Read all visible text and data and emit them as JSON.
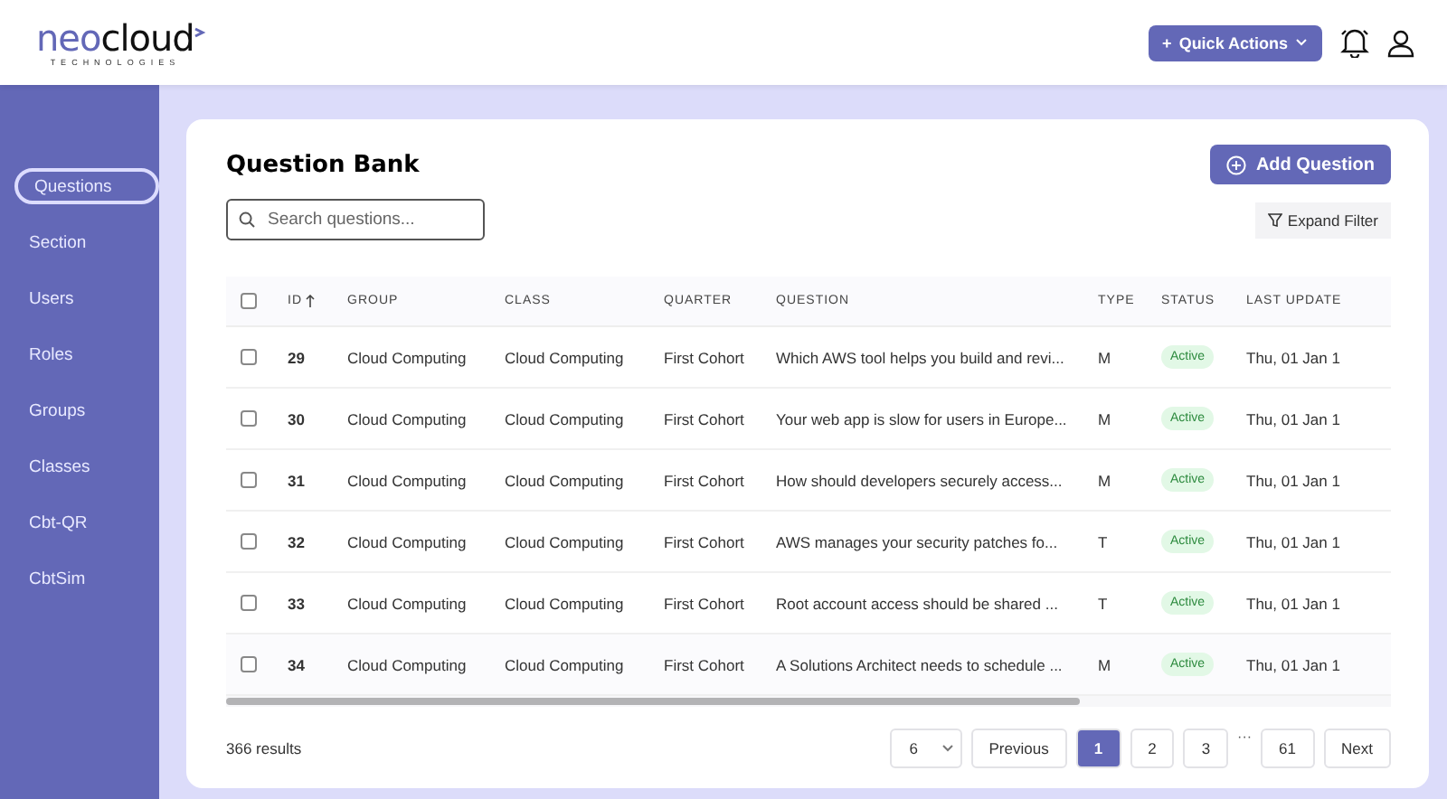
{
  "header": {
    "logo": {
      "brand_part1": "neo",
      "brand_part2": "cloud",
      "tagline": "TECHNOLOGIES"
    },
    "quick_actions": {
      "label": "Quick Actions",
      "prefix": "+"
    }
  },
  "sidebar": {
    "items": [
      {
        "label": "Questions",
        "selected": true
      },
      {
        "label": "Section",
        "selected": false
      },
      {
        "label": "Users",
        "selected": false
      },
      {
        "label": "Roles",
        "selected": false
      },
      {
        "label": "Groups",
        "selected": false
      },
      {
        "label": "Classes",
        "selected": false
      },
      {
        "label": "Cbt-QR",
        "selected": false
      },
      {
        "label": "CbtSim",
        "selected": false
      }
    ]
  },
  "page": {
    "title": "Question Bank",
    "add_button": "Add Question",
    "search": {
      "placeholder": "Search questions..."
    },
    "filter_button": "Expand Filter"
  },
  "table": {
    "columns": [
      {
        "label": "ID",
        "sorted": true
      },
      {
        "label": "GROUP",
        "sorted": false
      },
      {
        "label": "CLASS",
        "sorted": false
      },
      {
        "label": "QUARTER",
        "sorted": false
      },
      {
        "label": "QUESTION",
        "sorted": false
      },
      {
        "label": "TYPE",
        "sorted": false
      },
      {
        "label": "STATUS",
        "sorted": false
      },
      {
        "label": "LAST UPDATE",
        "sorted": false
      }
    ],
    "all_checked": false,
    "rows": [
      {
        "checked": false,
        "id": "29",
        "group": "Cloud Computing",
        "class": "Cloud Computing",
        "quarter": "First Cohort",
        "question": "Which AWS tool helps you build and revi...",
        "type": "M",
        "status": "Active",
        "last_update": "Thu, 01 Jan 1"
      },
      {
        "checked": false,
        "id": "30",
        "group": "Cloud Computing",
        "class": "Cloud Computing",
        "quarter": "First Cohort",
        "question": "Your web app is slow for users in Europe...",
        "type": "M",
        "status": "Active",
        "last_update": "Thu, 01 Jan 1"
      },
      {
        "checked": false,
        "id": "31",
        "group": "Cloud Computing",
        "class": "Cloud Computing",
        "quarter": "First Cohort",
        "question": "How should developers securely access...",
        "type": "M",
        "status": "Active",
        "last_update": "Thu, 01 Jan 1"
      },
      {
        "checked": false,
        "id": "32",
        "group": "Cloud Computing",
        "class": "Cloud Computing",
        "quarter": "First Cohort",
        "question": "AWS manages your security patches fo...",
        "type": "T",
        "status": "Active",
        "last_update": "Thu, 01 Jan 1"
      },
      {
        "checked": false,
        "id": "33",
        "group": "Cloud Computing",
        "class": "Cloud Computing",
        "quarter": "First Cohort",
        "question": "Root account access should be shared ...",
        "type": "T",
        "status": "Active",
        "last_update": "Thu, 01 Jan 1"
      },
      {
        "checked": false,
        "id": "34",
        "group": "Cloud Computing",
        "class": "Cloud Computing",
        "quarter": "First Cohort",
        "question": "A Solutions Architect needs to schedule ...",
        "type": "M",
        "status": "Active",
        "last_update": "Thu, 01 Jan 1"
      }
    ]
  },
  "footer": {
    "results": "366 results",
    "page_size": "6",
    "previous": "Previous",
    "next": "Next",
    "pages": [
      {
        "label": "1",
        "kind": "page",
        "selected": true
      },
      {
        "label": "2",
        "kind": "page",
        "selected": false
      },
      {
        "label": "3",
        "kind": "page",
        "selected": false
      },
      {
        "label": "···",
        "kind": "ellipsis"
      },
      {
        "label": "61",
        "kind": "page",
        "selected": false
      }
    ]
  }
}
